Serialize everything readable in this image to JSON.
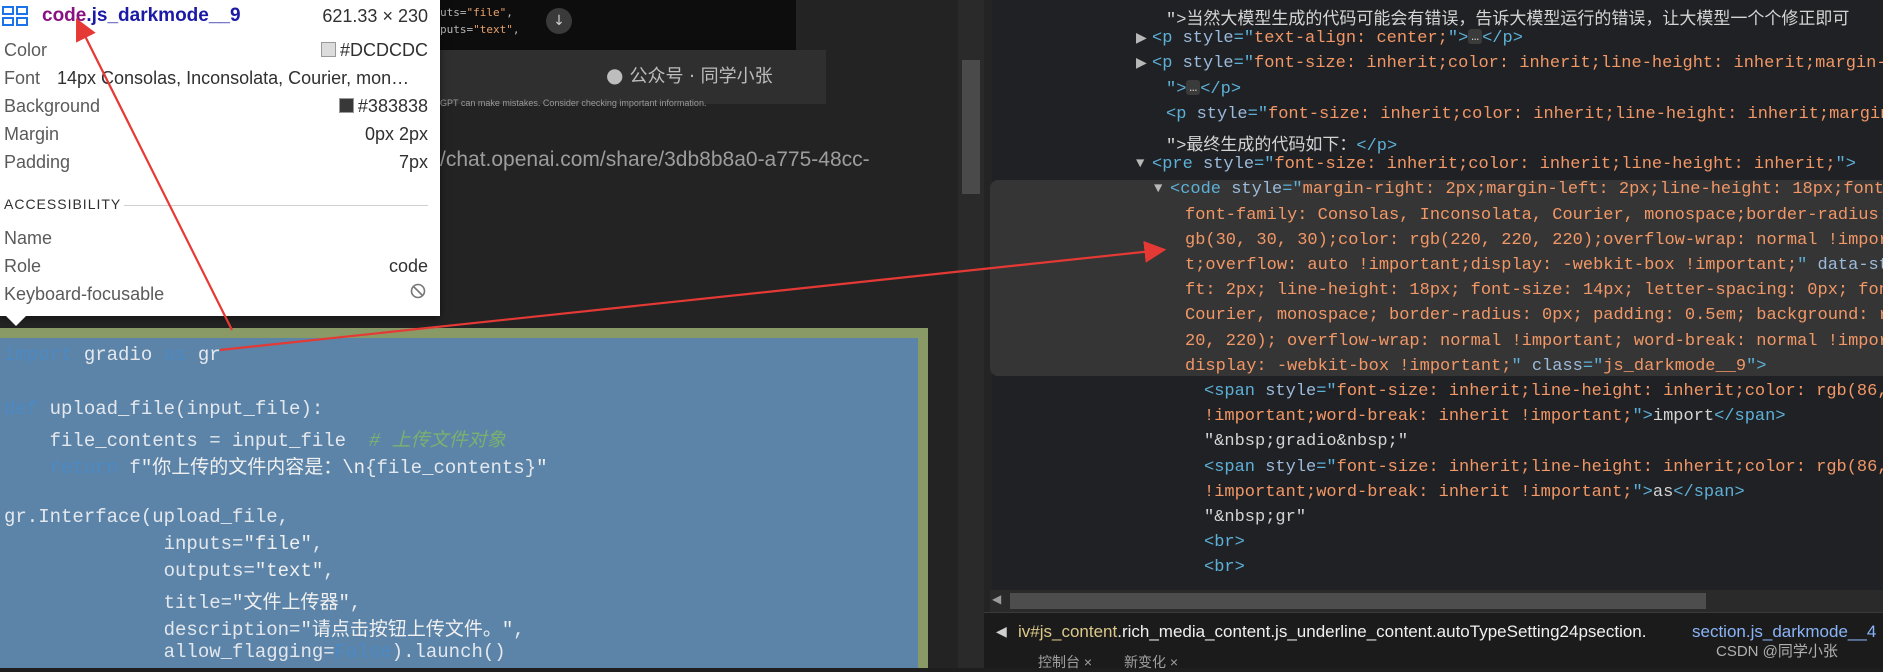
{
  "left_page": {
    "top_snippet_lines": [
      {
        "prefix": "uts=",
        "str": "\"file\"",
        "suffix": ","
      },
      {
        "prefix": "puts=",
        "str": "\"text\"",
        "suffix": ","
      }
    ],
    "scroll_down_glyph": "↓",
    "watermark": "公众号 · 同学小张",
    "disclaimer": "GPT can make mistakes. Consider checking important information.",
    "share_url": "/chat.openai.com/share/3db8b8a0-a775-48cc-"
  },
  "tooltip": {
    "element_tag": "code",
    "element_class": ".js_darkmode__9",
    "element_size": "621.33 × 230",
    "props": [
      {
        "key": "Color",
        "value": "#DCDCDC",
        "swatch": "#dcdcdc"
      },
      {
        "key": "Font",
        "value": "14px Consolas, Inconsolata, Courier, mon…"
      },
      {
        "key": "Background",
        "value": "#383838",
        "swatch": "#383838"
      },
      {
        "key": "Margin",
        "value": "0px 2px"
      },
      {
        "key": "Padding",
        "value": "7px"
      }
    ],
    "accessibility_heading": "ACCESSIBILITY",
    "a11y": [
      {
        "key": "Name",
        "value": ""
      },
      {
        "key": "Role",
        "value": "code"
      },
      {
        "key": "Keyboard-focusable",
        "value": ""
      }
    ]
  },
  "code_block": {
    "lines": [
      [
        {
          "t": "import",
          "c": "kw"
        },
        {
          "t": " gradio ",
          "c": ""
        },
        {
          "t": "as",
          "c": "kw"
        },
        {
          "t": " gr",
          "c": ""
        }
      ],
      [],
      [
        {
          "t": "def",
          "c": "kw"
        },
        {
          "t": " upload_file(input_file):",
          "c": ""
        }
      ],
      [
        {
          "t": "    file_contents = input_file  ",
          "c": ""
        },
        {
          "t": "# 上传文件对象",
          "c": "cmt"
        }
      ],
      [
        {
          "t": "    ",
          "c": ""
        },
        {
          "t": "return",
          "c": "kw"
        },
        {
          "t": " f",
          "c": ""
        },
        {
          "t": "\"你上传的文件内容是：\\n",
          "c": "str"
        },
        {
          "t": "{file_contents}",
          "c": ""
        },
        {
          "t": "\"",
          "c": "str"
        }
      ],
      [],
      [
        {
          "t": "gr.Interface(upload_file,",
          "c": ""
        }
      ],
      [
        {
          "t": "              inputs=",
          "c": ""
        },
        {
          "t": "\"file\"",
          "c": "str"
        },
        {
          "t": ",",
          "c": ""
        }
      ],
      [
        {
          "t": "              outputs=",
          "c": ""
        },
        {
          "t": "\"text\"",
          "c": "str"
        },
        {
          "t": ",",
          "c": ""
        }
      ],
      [
        {
          "t": "              title=",
          "c": ""
        },
        {
          "t": "\"文件上传器\"",
          "c": "str"
        },
        {
          "t": ",",
          "c": ""
        }
      ],
      [
        {
          "t": "              description=",
          "c": ""
        },
        {
          "t": "\"请点击按钮上传文件。\"",
          "c": "str"
        },
        {
          "t": ",",
          "c": ""
        }
      ],
      [
        {
          "t": "              allow_flagging=",
          "c": ""
        },
        {
          "t": "False",
          "c": "bool"
        },
        {
          "t": ").launch()",
          "c": ""
        }
      ]
    ]
  },
  "devtools": {
    "lines": [
      {
        "indent": 1166,
        "parts": [
          {
            "t": "\">当然大模型生成的代码可能会有错误，告诉大模型运行的错误，让大模型一个个修正即可",
            "c": "tx"
          }
        ]
      },
      {
        "indent": 1152,
        "tri": "▶",
        "parts": [
          {
            "t": "<p ",
            "c": "tg"
          },
          {
            "t": "style",
            "c": "at"
          },
          {
            "t": "=\"",
            "c": "tg"
          },
          {
            "t": "text-align: center;",
            "c": "av"
          },
          {
            "t": "\">",
            "c": "tg"
          },
          {
            "t": "…",
            "c": "ell"
          },
          {
            "t": "</p>",
            "c": "tg"
          }
        ]
      },
      {
        "indent": 1152,
        "tri": "▶",
        "parts": [
          {
            "t": "<p ",
            "c": "tg"
          },
          {
            "t": "style",
            "c": "at"
          },
          {
            "t": "=\"",
            "c": "tg"
          },
          {
            "t": "font-size: inherit;color: inherit;line-height: inherit;margin-",
            "c": "av"
          }
        ]
      },
      {
        "indent": 1166,
        "parts": [
          {
            "t": "\">",
            "c": "tg"
          },
          {
            "t": "…",
            "c": "ell"
          },
          {
            "t": "</p>",
            "c": "tg"
          }
        ]
      },
      {
        "indent": 1166,
        "parts": [
          {
            "t": "<p ",
            "c": "tg"
          },
          {
            "t": "style",
            "c": "at"
          },
          {
            "t": "=\"",
            "c": "tg"
          },
          {
            "t": "font-size: inherit;color: inherit;line-height: inherit;margin-",
            "c": "av"
          }
        ]
      },
      {
        "indent": 1166,
        "parts": [
          {
            "t": "\">最终生成的代码如下：",
            "c": "tx"
          },
          {
            "t": "</p>",
            "c": "tg"
          }
        ]
      },
      {
        "indent": 1152,
        "tri": "▼",
        "parts": [
          {
            "t": "<pre ",
            "c": "tg"
          },
          {
            "t": "style",
            "c": "at"
          },
          {
            "t": "=\"",
            "c": "tg"
          },
          {
            "t": "font-size: inherit;color: inherit;line-height: inherit;",
            "c": "av"
          },
          {
            "t": "\">",
            "c": "tg"
          }
        ]
      },
      {
        "indent": 1170,
        "tri": "▼",
        "parts": [
          {
            "t": "<code ",
            "c": "tg"
          },
          {
            "t": "style",
            "c": "at"
          },
          {
            "t": "=\"",
            "c": "tg"
          },
          {
            "t": "margin-right: 2px;margin-left: 2px;line-height: 18px;font-",
            "c": "av"
          }
        ]
      },
      {
        "indent": 1185,
        "parts": [
          {
            "t": "font-family: Consolas, Inconsolata, Courier, monospace;border-radius: 0",
            "c": "av"
          }
        ]
      },
      {
        "indent": 1185,
        "parts": [
          {
            "t": "gb(30, 30, 30);color: rgb(220, 220, 220);overflow-wrap: normal !importa",
            "c": "av"
          }
        ]
      },
      {
        "indent": 1185,
        "parts": [
          {
            "t": "t;overflow: auto !important;display: -webkit-box !important;",
            "c": "av"
          },
          {
            "t": "\" ",
            "c": "tg"
          },
          {
            "t": "data-styl",
            "c": "at"
          }
        ]
      },
      {
        "indent": 1185,
        "parts": [
          {
            "t": "ft: 2px; line-height: 18px; font-size: 14px; letter-spacing: 0px; font-",
            "c": "av"
          }
        ]
      },
      {
        "indent": 1185,
        "parts": [
          {
            "t": "Courier, monospace; border-radius: 0px; padding: 0.5em; background: rgb",
            "c": "av"
          }
        ]
      },
      {
        "indent": 1185,
        "parts": [
          {
            "t": "20, 220); overflow-wrap: normal !important; word-break: normal !importa",
            "c": "av"
          }
        ]
      },
      {
        "indent": 1185,
        "parts": [
          {
            "t": "display: -webkit-box !important;",
            "c": "av"
          },
          {
            "t": "\" ",
            "c": "tg"
          },
          {
            "t": "class",
            "c": "at"
          },
          {
            "t": "=\"",
            "c": "tg"
          },
          {
            "t": "js_darkmode__9",
            "c": "av"
          },
          {
            "t": "\">",
            "c": "tg"
          }
        ]
      },
      {
        "indent": 1204,
        "parts": [
          {
            "t": "<span ",
            "c": "tg"
          },
          {
            "t": "style",
            "c": "at"
          },
          {
            "t": "=\"",
            "c": "tg"
          },
          {
            "t": "font-size: inherit;line-height: inherit;color: rgb(86, 1",
            "c": "av"
          }
        ]
      },
      {
        "indent": 1204,
        "parts": [
          {
            "t": "!important;word-break: inherit !important;",
            "c": "av"
          },
          {
            "t": "\">",
            "c": "tg"
          },
          {
            "t": "import",
            "c": "tx"
          },
          {
            "t": "</span>",
            "c": "tg"
          }
        ]
      },
      {
        "indent": 1204,
        "parts": [
          {
            "t": "\"&nbsp;gradio&nbsp;\"",
            "c": "tx"
          }
        ]
      },
      {
        "indent": 1204,
        "parts": [
          {
            "t": "<span ",
            "c": "tg"
          },
          {
            "t": "style",
            "c": "at"
          },
          {
            "t": "=\"",
            "c": "tg"
          },
          {
            "t": "font-size: inherit;line-height: inherit;color: rgb(86, 1",
            "c": "av"
          }
        ]
      },
      {
        "indent": 1204,
        "parts": [
          {
            "t": "!important;word-break: inherit !important;",
            "c": "av"
          },
          {
            "t": "\">",
            "c": "tg"
          },
          {
            "t": "as",
            "c": "tx"
          },
          {
            "t": "</span>",
            "c": "tg"
          }
        ]
      },
      {
        "indent": 1204,
        "parts": [
          {
            "t": "\"&nbsp;gr\"",
            "c": "tx"
          }
        ]
      },
      {
        "indent": 1204,
        "parts": [
          {
            "t": "<br>",
            "c": "tg"
          }
        ]
      },
      {
        "indent": 1204,
        "parts": [
          {
            "t": "<br>",
            "c": "tg"
          }
        ]
      }
    ],
    "breadcrumb": {
      "left_arrow": "◀",
      "crumb1_prefix": "iv#js_content",
      "crumb1_classes": ".rich_media_content.js_underline_content.autoTypeSetting24psection.",
      "crumb2": "section.js_darkmode__4"
    },
    "drawer_tabs": [
      "控制台 ×",
      "新变化 ×"
    ],
    "watermark": "CSDN @同学小张"
  }
}
